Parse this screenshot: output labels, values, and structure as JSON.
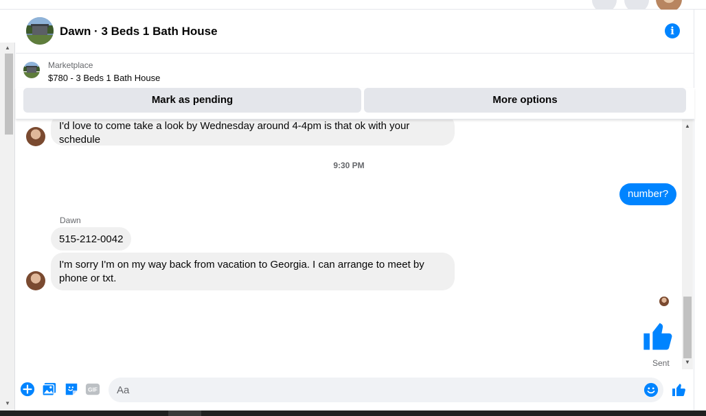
{
  "header": {
    "title": "Dawn · 3 Beds 1 Bath House",
    "info_icon": "info-icon"
  },
  "listing": {
    "source": "Marketplace",
    "item": "$780 - 3 Beds 1 Bath House"
  },
  "actions": {
    "mark_pending": "Mark as pending",
    "more_options": "More options"
  },
  "messages": [
    {
      "direction": "incoming",
      "text": "I'd love to come take a look by Wednesday around 4-4pm is that ok with your schedule"
    },
    {
      "type": "timestamp",
      "text": "9:30 PM"
    },
    {
      "direction": "outgoing",
      "text": "number?"
    },
    {
      "direction": "incoming",
      "sender": "Dawn",
      "text": "515-212-0042"
    },
    {
      "direction": "incoming",
      "text": "I'm sorry I'm on my way back from vacation to Georgia. I can arrange to meet by phone or txt."
    },
    {
      "direction": "outgoing",
      "type": "like-sticker"
    }
  ],
  "status": {
    "sent": "Sent"
  },
  "composer": {
    "placeholder": "Aa"
  },
  "colors": {
    "accent": "#0084ff",
    "bubble_in": "#f0f0f0",
    "button_bg": "#e4e6eb"
  }
}
